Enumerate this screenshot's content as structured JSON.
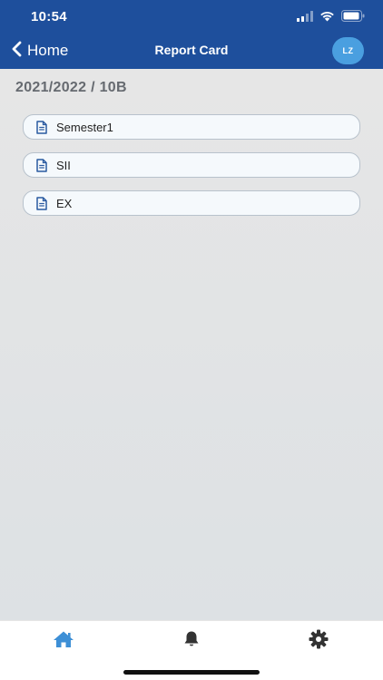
{
  "status_bar": {
    "time": "10:54"
  },
  "nav": {
    "back_label": "Home",
    "title": "Report Card",
    "avatar_initials": "LZ"
  },
  "class_heading": "2021/2022 / 10B",
  "reports": [
    {
      "label": "Semester1"
    },
    {
      "label": "SII"
    },
    {
      "label": "EX"
    }
  ],
  "tabs": [
    {
      "icon": "home-icon",
      "active": true
    },
    {
      "icon": "bell-icon",
      "active": false
    },
    {
      "icon": "gear-icon",
      "active": false
    }
  ],
  "colors": {
    "header": "#1e4f9c",
    "avatar": "#4a9fe0",
    "active_tab": "#3d8fd6",
    "inactive_tab": "#333333"
  }
}
